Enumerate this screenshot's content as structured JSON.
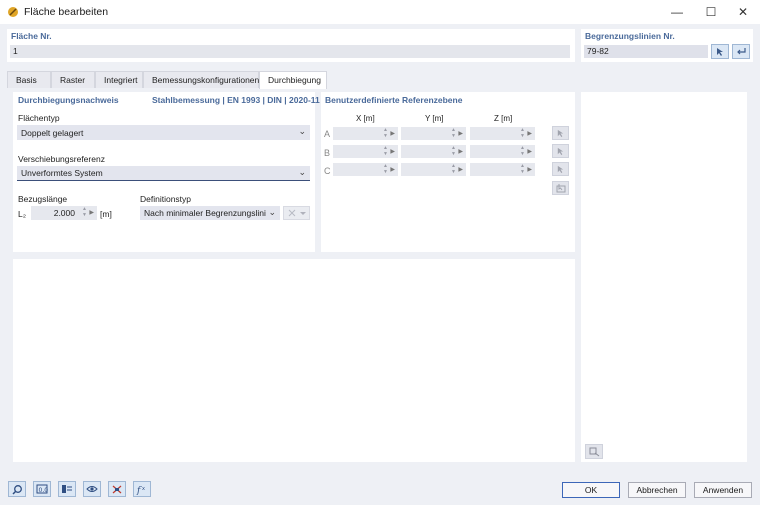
{
  "window": {
    "title": "Fläche bearbeiten"
  },
  "header": {
    "flaeche_label": "Fläche Nr.",
    "flaeche_value": "1",
    "begrenzung_label": "Begrenzungslinien Nr.",
    "begrenzung_value": "79-82"
  },
  "tabs": [
    "Basis",
    "Raster",
    "Integriert",
    "Bemessungskonfigurationen",
    "Durchbiegung"
  ],
  "left_section": {
    "title": "Durchbiegungsnachweis",
    "subtitle": "Stahlbemessung | EN 1993 | DIN | 2020-11",
    "flaechentyp_label": "Flächentyp",
    "flaechentyp_value": "Doppelt gelagert",
    "verschiebung_label": "Verschiebungsreferenz",
    "verschiebung_value": "Unverformtes System",
    "bezug_label": "Bezugslänge",
    "lz_label": "L₂",
    "lz_value": "2.000",
    "lz_unit": "[m]",
    "defin_label": "Definitionstyp",
    "defin_value": "Nach minimaler Begrenzungslinie"
  },
  "ref_section": {
    "title": "Benutzerdefinierte Referenzebene",
    "columns": [
      "X [m]",
      "Y [m]",
      "Z [m]"
    ],
    "rows": [
      "A",
      "B",
      "C"
    ]
  },
  "buttons": {
    "ok": "OK",
    "cancel": "Abbrechen",
    "apply": "Anwenden"
  },
  "colors": {
    "accent": "#3d67b8",
    "section_title": "#4a6a9a",
    "background": "#eef0f5"
  }
}
